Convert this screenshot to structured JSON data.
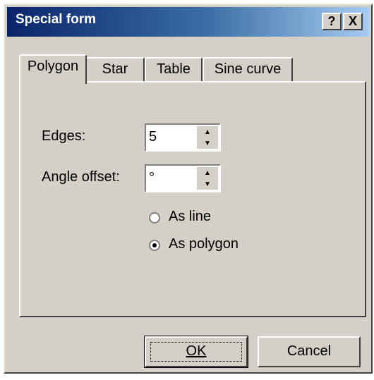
{
  "window": {
    "title": "Special form",
    "help_icon": "?",
    "close_icon": "X"
  },
  "tabs": [
    {
      "label": "Polygon",
      "active": true
    },
    {
      "label": "Star",
      "active": false
    },
    {
      "label": "Table",
      "active": false
    },
    {
      "label": "Sine curve",
      "active": false
    }
  ],
  "fields": {
    "edges_label": "Edges:",
    "edges_value": "5",
    "angle_label": "Angle offset:",
    "angle_value": "°"
  },
  "radios": {
    "as_line": "As line",
    "as_polygon": "As polygon",
    "selected": "As polygon"
  },
  "buttons": {
    "ok_label": "OK",
    "cancel_label": "Cancel"
  },
  "colors": {
    "title_bar_start": "#0a246a",
    "title_bar_end": "#a6caf0",
    "face": "#d4d0c8"
  }
}
